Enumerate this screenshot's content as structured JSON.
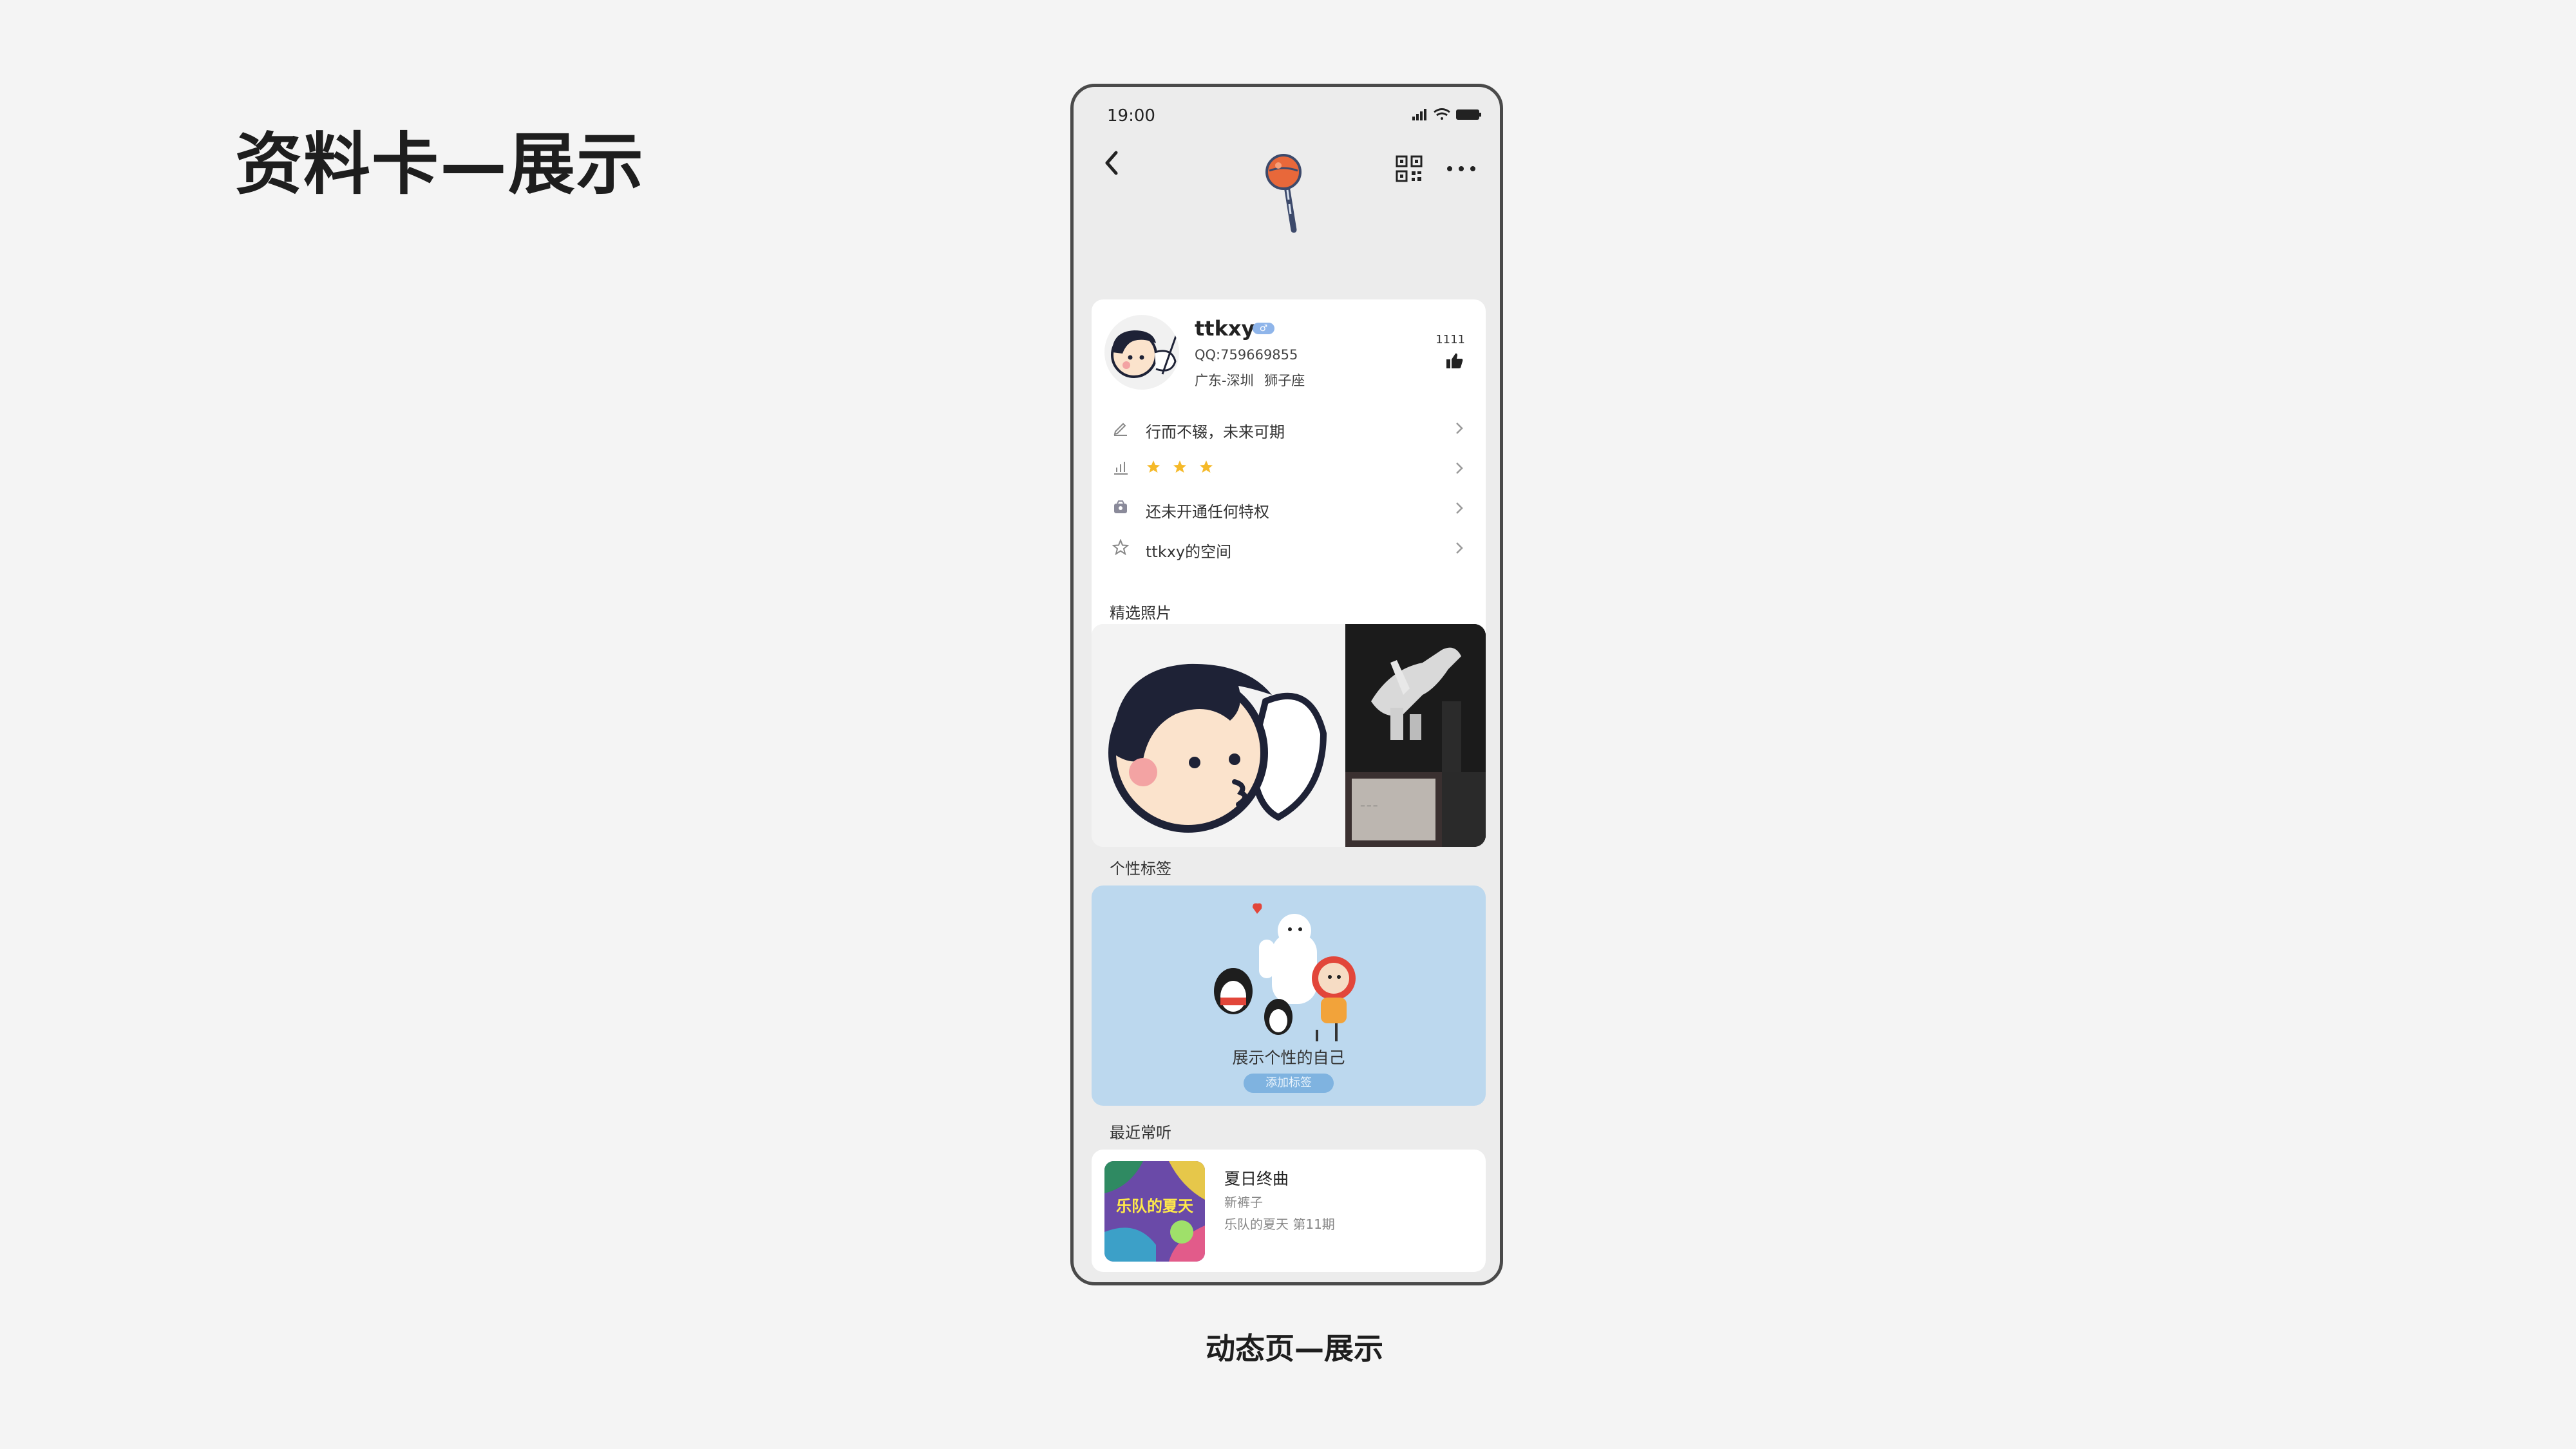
{
  "slide": {
    "title": "资料卡—展示",
    "caption": "动态页—展示"
  },
  "status_bar": {
    "time": "19:00",
    "icons": [
      "signal-icon",
      "wifi-icon",
      "battery-icon"
    ]
  },
  "nav": {
    "icons": [
      "back-icon",
      "lollipop-logo",
      "qr-code-icon",
      "more-icon"
    ]
  },
  "profile": {
    "nickname": "ttkxy",
    "qq": "QQ:759669855",
    "location": "广东-深圳",
    "zodiac": "狮子座",
    "likes": "1111"
  },
  "info_rows": [
    {
      "icon": "pencil-icon",
      "text": "行而不辍，未来可期"
    },
    {
      "icon": "level-chart-icon",
      "stars": 3,
      "text": ""
    },
    {
      "icon": "vip-icon",
      "text": "还未开通任何特权"
    },
    {
      "icon": "star-outline-icon",
      "text": "ttkxy的空间"
    }
  ],
  "sections": {
    "photos_label": "精选照片",
    "tags_label": "个性标签",
    "music_label": "最近常听"
  },
  "tags": {
    "text": "展示个性的自己",
    "button": "添加标签"
  },
  "music": {
    "title": "夏日终曲",
    "artist": "新裤子",
    "album": "乐队的夏天 第11期",
    "cover_text": "乐队的夏天"
  },
  "colors": {
    "background": "#f4f4f4",
    "phone_bg": "#ececec",
    "tag_card": "#bcd8ee",
    "star": "#f5b928",
    "accent_blue": "#7fb3e0",
    "lollipop": "#e8683a"
  }
}
